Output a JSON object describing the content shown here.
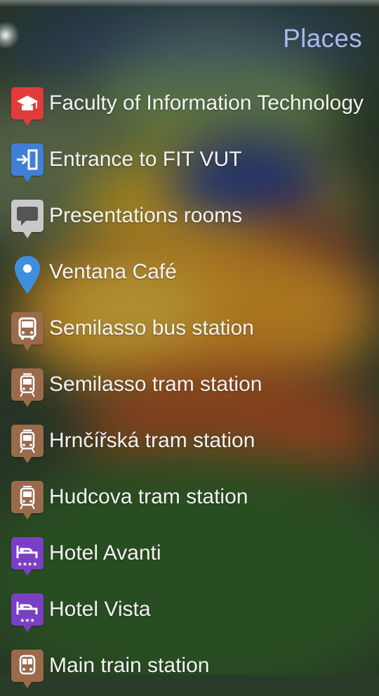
{
  "header": {
    "title": "Places"
  },
  "places": [
    {
      "name": "Faculty of Information Technology",
      "icon": "school-icon",
      "color": "#e33b3b"
    },
    {
      "name": "Entrance to FIT VUT",
      "icon": "entrance-icon",
      "color": "#3f7fd6"
    },
    {
      "name": "Presentations rooms",
      "icon": "speech-bubble-icon",
      "color": "#c9c9c9"
    },
    {
      "name": "Ventana Café",
      "icon": "map-marker-icon",
      "color": "#3f8fe0"
    },
    {
      "name": "Semilasso bus station",
      "icon": "bus-icon",
      "color": "#9a6a4a"
    },
    {
      "name": "Semilasso tram station",
      "icon": "tram-icon",
      "color": "#9a6a4a"
    },
    {
      "name": "Hrnčířská tram station",
      "icon": "tram-icon",
      "color": "#9a6a4a"
    },
    {
      "name": "Hudcova tram station",
      "icon": "tram-icon",
      "color": "#9a6a4a"
    },
    {
      "name": "Hotel Avanti",
      "icon": "hotel-icon",
      "color": "#7b3fc6"
    },
    {
      "name": "Hotel Vista",
      "icon": "hotel-icon",
      "color": "#7b3fc6"
    },
    {
      "name": "Main train station",
      "icon": "train-icon",
      "color": "#9a6a4a"
    }
  ]
}
